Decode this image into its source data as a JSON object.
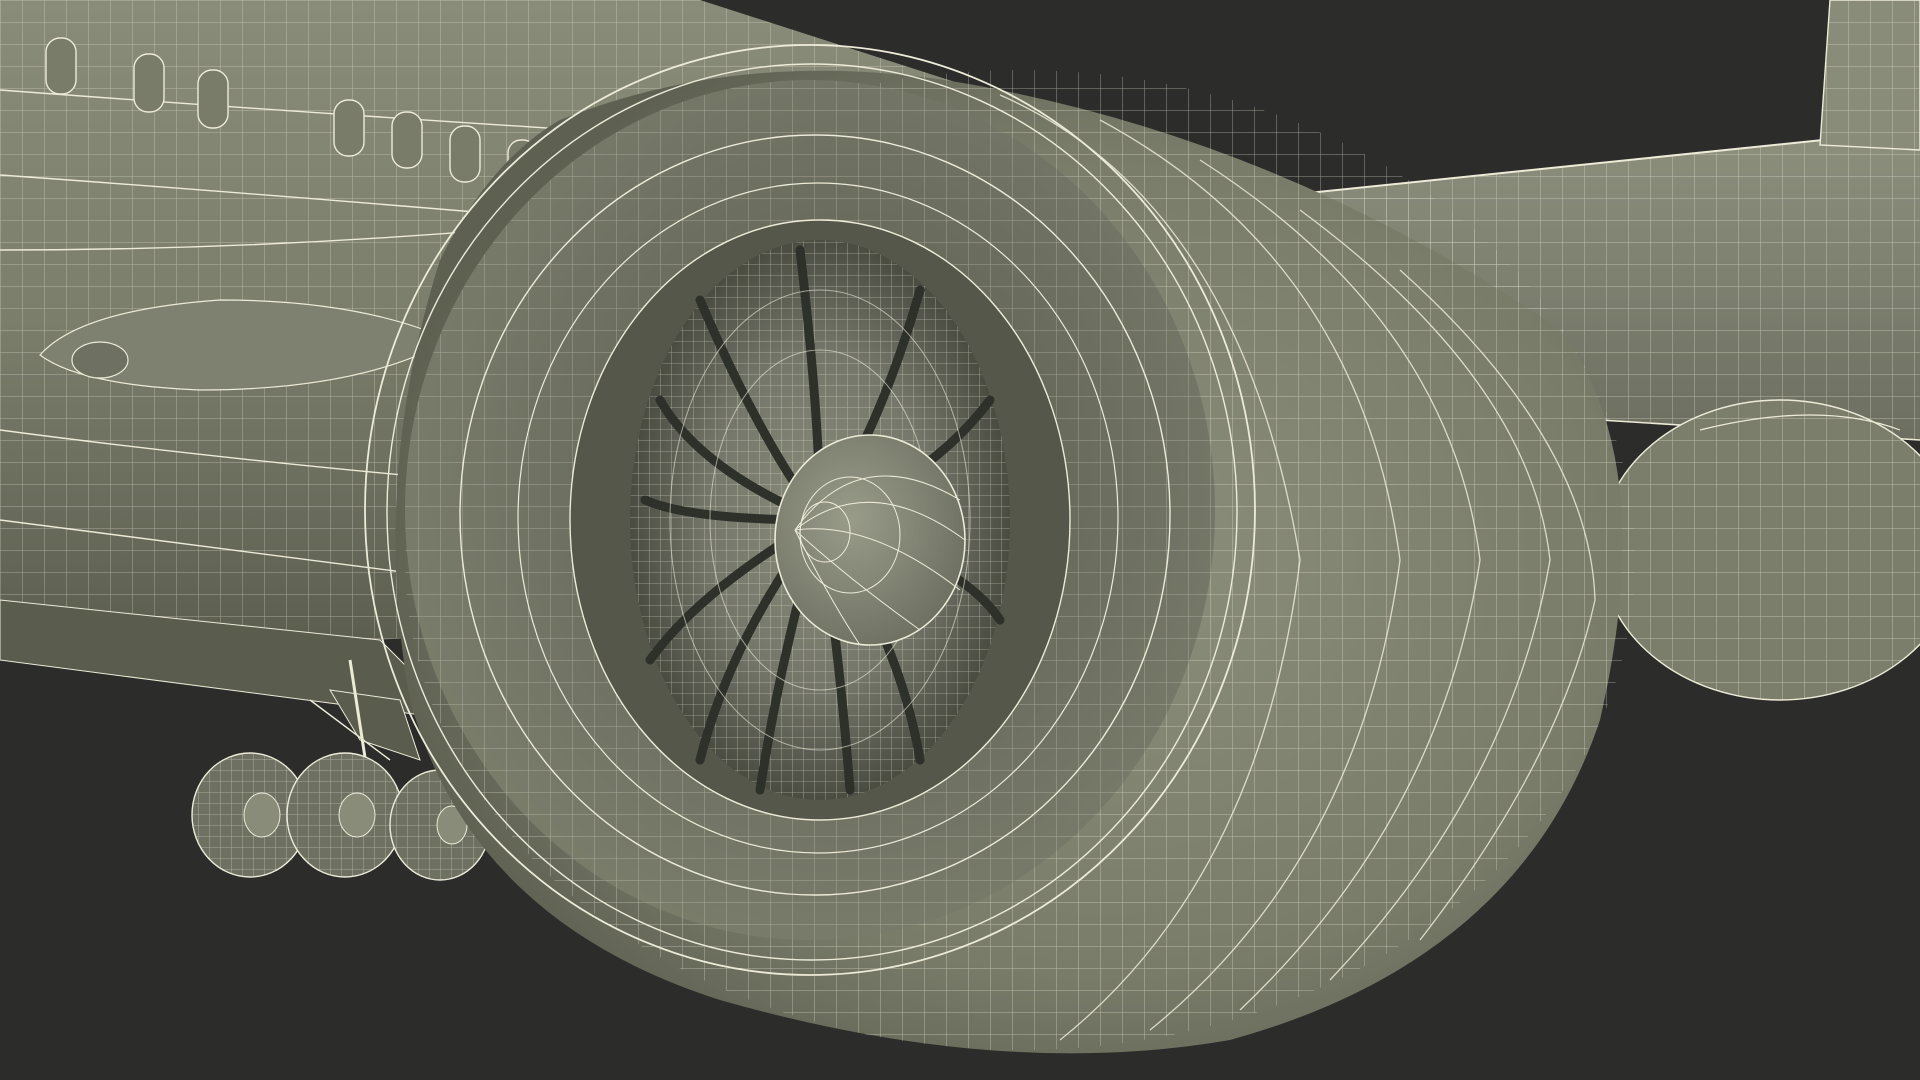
{
  "scene": {
    "subject": "wireframe-airliner-engine-render",
    "colors": {
      "background": "#2c2c2a",
      "surface_light": "#8a8c7a",
      "surface_mid": "#767866",
      "surface_dark": "#4e5044",
      "surface_shadow": "#3a3c34",
      "wire": "#ecebd8"
    }
  }
}
